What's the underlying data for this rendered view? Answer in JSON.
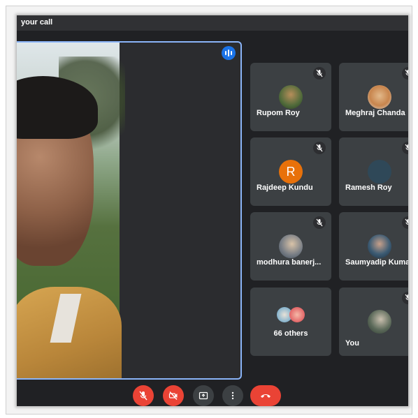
{
  "window": {
    "title_fragment": "your call"
  },
  "participants": [
    {
      "name": "Rupom Roy",
      "avatar": "photo"
    },
    {
      "name": "Meghraj Chanda",
      "avatar": "photo"
    },
    {
      "name": "Rajdeep Kundu",
      "avatar": "initial",
      "initial": "R"
    },
    {
      "name": "Ramesh Roy",
      "avatar": "blank"
    },
    {
      "name": "modhura banerj...",
      "avatar": "photo"
    },
    {
      "name": "Saumyadip Kuma",
      "avatar": "photo"
    },
    {
      "name": "66 others",
      "avatar": "stack"
    },
    {
      "name": "You",
      "avatar": "photo"
    }
  ],
  "icons": {
    "speaking": "audio-level-icon",
    "muted": "mic-off-icon",
    "mic": "mic-off-icon",
    "camera": "camera-off-icon",
    "present": "present-screen-icon",
    "more": "more-vert-icon",
    "end_call": "call-end-icon"
  },
  "colors": {
    "accent": "#8ab4f8",
    "danger": "#ea4335",
    "tile_bg": "#3c4043",
    "background": "#202124"
  }
}
